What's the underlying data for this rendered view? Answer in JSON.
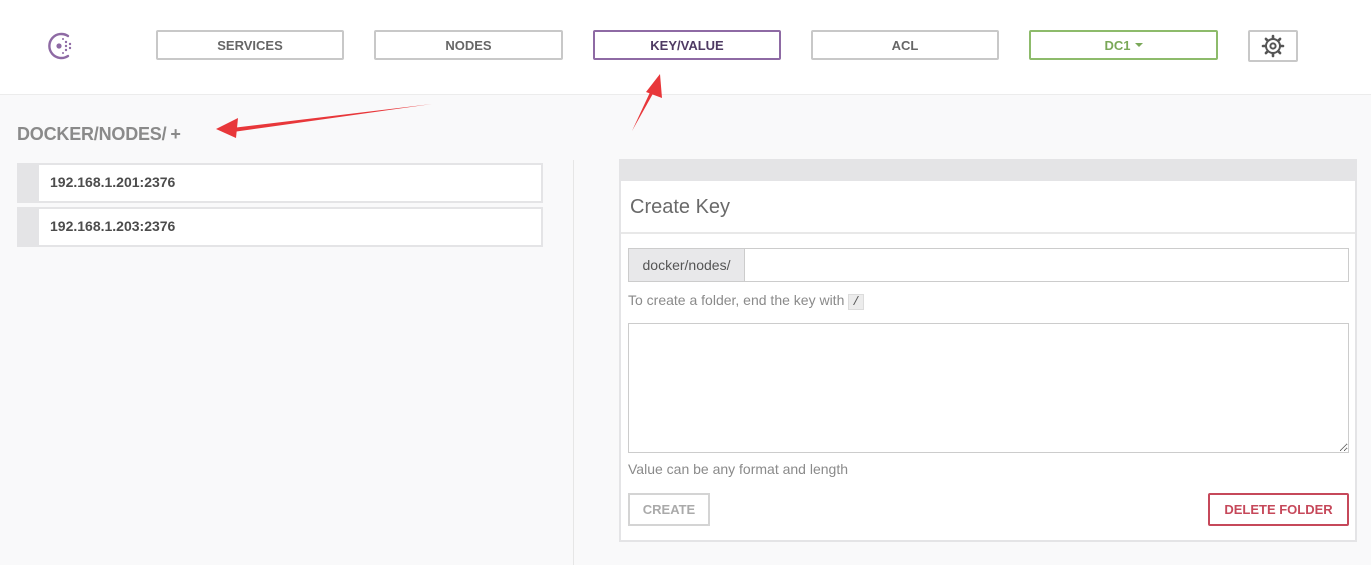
{
  "nav": {
    "services": "SERVICES",
    "nodes": "NODES",
    "keyvalue": "KEY/VALUE",
    "acl": "ACL",
    "datacenter": "DC1"
  },
  "breadcrumb": {
    "path": "DOCKER/NODES/",
    "add": "+"
  },
  "keys": [
    {
      "label": "192.168.1.201:2376"
    },
    {
      "label": "192.168.1.203:2376"
    }
  ],
  "create_key": {
    "title": "Create Key",
    "prefix": "docker/nodes/",
    "key_value": "",
    "key_help": "To create a folder, end the key with",
    "key_help_code": "/",
    "value_text": "",
    "value_help": "Value can be any format and length",
    "create_label": "CREATE",
    "delete_label": "DELETE FOLDER"
  },
  "colors": {
    "active_nav": "#8e6aa4",
    "datacenter": "#8dbb6b",
    "danger": "#c6485a",
    "annotation_arrow": "#e8373a"
  },
  "icons": {
    "logo": "consul-logo-icon",
    "settings": "gear-icon",
    "dropdown": "caret-down-icon"
  }
}
